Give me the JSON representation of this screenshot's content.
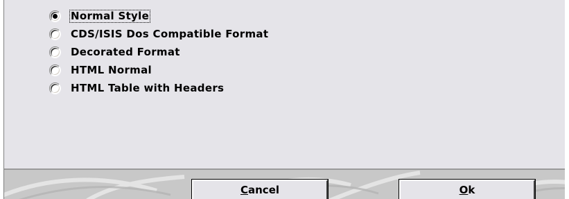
{
  "format_options": {
    "selected_index": 0,
    "items": [
      {
        "label": "Normal Style"
      },
      {
        "label": "CDS/ISIS Dos Compatible Format"
      },
      {
        "label": "Decorated Format"
      },
      {
        "label": "HTML Normal"
      },
      {
        "label": "HTML Table with Headers"
      }
    ]
  },
  "buttons": {
    "cancel": {
      "mnemonic": "C",
      "rest": "ancel"
    },
    "ok": {
      "mnemonic": "O",
      "rest": "k"
    }
  },
  "colors": {
    "dialog_background": "#e5e4e9",
    "button_bar_background": "#c8c8c8"
  }
}
